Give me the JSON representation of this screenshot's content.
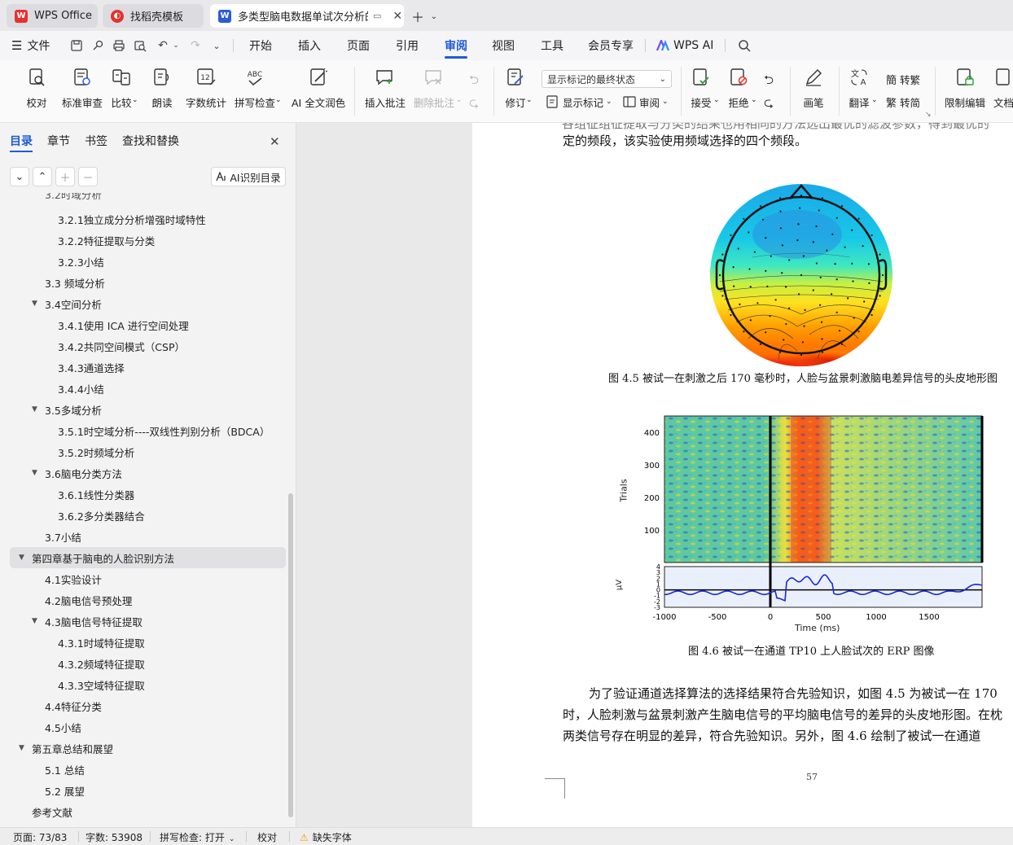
{
  "tabs": [
    {
      "label": "WPS Office",
      "icon": "wps-logo-icon"
    },
    {
      "label": "找稻壳模板",
      "icon": "docer-icon"
    },
    {
      "label": "多类型脑电数据单试次分析的",
      "icon": "word-doc-icon"
    }
  ],
  "menu": [
    "文件",
    "开始",
    "插入",
    "页面",
    "引用",
    "审阅",
    "视图",
    "工具",
    "会员专享",
    "WPS AI"
  ],
  "ribbon": {
    "proofread": "校对",
    "standard_review": "标准审查",
    "compare": "比较",
    "read_aloud": "朗读",
    "word_count": "字数统计",
    "spell_check": "拼写检查",
    "ai_polish": "AI 全文润色",
    "insert_comment": "插入批注",
    "delete_comment": "删除批注",
    "markup_mode": "显示标记的最终状态",
    "revise": "修订",
    "show_markup": "显示标记",
    "review": "审阅",
    "accept": "接受",
    "reject": "拒绝",
    "pen": "画笔",
    "translate": "翻译",
    "to_traditional": "转繁",
    "to_simplified": "转简",
    "restrict_edit": "限制编辑",
    "doc_partial": "文档"
  },
  "nav": {
    "tabs": [
      "目录",
      "章节",
      "书签",
      "查找和替换"
    ],
    "ai_toc": "AI识别目录",
    "items": [
      {
        "text": "3.2.1独立成分分析增强时域特性",
        "level": 3
      },
      {
        "text": "3.2.2特征提取与分类",
        "level": 3
      },
      {
        "text": "3.2.3小结",
        "level": 3
      },
      {
        "text": "3.3  频域分析",
        "level": 2
      },
      {
        "text": "3.4空间分析",
        "level": 2,
        "expanded": true
      },
      {
        "text": "3.4.1使用 ICA 进行空间处理",
        "level": 3
      },
      {
        "text": "3.4.2共同空间模式（CSP）",
        "level": 3
      },
      {
        "text": "3.4.3通道选择",
        "level": 3
      },
      {
        "text": "3.4.4小结",
        "level": 3
      },
      {
        "text": "3.5多域分析",
        "level": 2,
        "expanded": true
      },
      {
        "text": "3.5.1时空域分析----双线性判别分析（BDCA）",
        "level": 3
      },
      {
        "text": "3.5.2时频域分析",
        "level": 3
      },
      {
        "text": "3.6脑电分类方法",
        "level": 2,
        "expanded": true
      },
      {
        "text": "3.6.1线性分类器",
        "level": 3
      },
      {
        "text": "3.6.2多分类器结合",
        "level": 3
      },
      {
        "text": "3.7小结",
        "level": 2
      },
      {
        "text": "第四章基于脑电的人脸识别方法",
        "level": 1,
        "expanded": true,
        "selected": true
      },
      {
        "text": "4.1实验设计",
        "level": 2
      },
      {
        "text": "4.2脑电信号预处理",
        "level": 2
      },
      {
        "text": "4.3脑电信号特征提取",
        "level": 2,
        "expanded": true
      },
      {
        "text": "4.3.1时域特征提取",
        "level": 3
      },
      {
        "text": "4.3.2频域特征提取",
        "level": 3
      },
      {
        "text": "4.3.3空域特征提取",
        "level": 3
      },
      {
        "text": "4.4特征分类",
        "level": 2
      },
      {
        "text": "4.5小结",
        "level": 2
      },
      {
        "text": "第五章总结和展望",
        "level": 1,
        "expanded": true
      },
      {
        "text": "5.1  总结",
        "level": 2
      },
      {
        "text": "5.2  展望",
        "level": 2
      },
      {
        "text": "参考文献",
        "level": 1
      }
    ]
  },
  "doc": {
    "top_line": "定的频段，该实验使用频域选择的四个频段。",
    "fig45_caption": "图 4.5  被试一在刺激之后 170 毫秒时，人脸与盆景刺激脑电差异信号的头皮地形图",
    "fig46_caption": "图 4.6  被试一在通道 TP10 上人脸试次的 ERP 图像",
    "para_lines": [
      "为了验证通道选择算法的选择结果符合先验知识，如图 4.5 为被试一在 170",
      "时，人脸刺激与盆景刺激产生脑电信号的平均脑电信号的差异的头皮地形图。在枕",
      "两类信号存在明显的差异，符合先验知识。另外，图 4.6 绘制了被试一在通道"
    ],
    "page_number": "57"
  },
  "chart_data": {
    "type": "heatmap",
    "title": "",
    "heatmap": {
      "ylabel": "Trials",
      "yticks": [
        100,
        200,
        300,
        400
      ]
    },
    "erp": {
      "ylabel": "μV",
      "yticks": [
        4,
        3,
        2,
        1,
        0,
        -1,
        -2,
        -3
      ],
      "ylim": [
        -3,
        4
      ]
    },
    "xlabel": "Time (ms)",
    "xticks": [
      -1000,
      -500,
      0,
      500,
      1000,
      1500
    ],
    "xlim": [
      -1000,
      2000
    ],
    "stimulus_onset_ms": 0
  },
  "status": {
    "page": "页面: 73/83",
    "words": "字数: 53908",
    "spell": "拼写检查: 打开",
    "proof": "校对",
    "missing_font": "缺失字体"
  },
  "colors": {
    "accent": "#1f5bd6",
    "wps_red": "#e5322d",
    "doc_blue": "#2d5bd6"
  }
}
